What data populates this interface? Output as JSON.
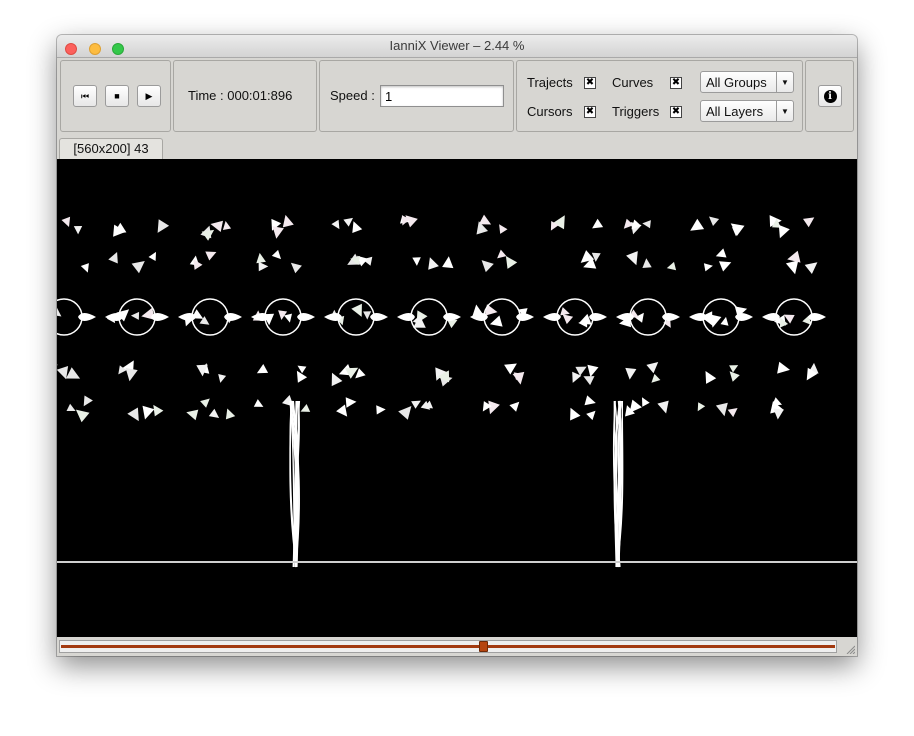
{
  "window": {
    "title": "IanniX Viewer – 2.44 %"
  },
  "transport": {
    "rewind_icon": "rewind-to-start-icon",
    "stop_icon": "stop-icon",
    "play_icon": "play-icon",
    "rewind_glyph": "⏮",
    "stop_glyph": "■",
    "play_glyph": "▶"
  },
  "time": {
    "label": "Time : 000:01:896"
  },
  "speed": {
    "label": "Speed :",
    "value": "1"
  },
  "visibility": {
    "trajects_label": "Trajects",
    "curves_label": "Curves",
    "cursors_label": "Cursors",
    "triggers_label": "Triggers",
    "check_glyph": "✖",
    "groups_selected": "All Groups",
    "layers_selected": "All Layers"
  },
  "info": {
    "glyph": "i",
    "icon": "info-icon"
  },
  "tabs": [
    {
      "label": "[560x200] 43"
    }
  ],
  "timeline": {
    "position_fraction": 0.545
  },
  "colors": {
    "canvas": "#000000",
    "objects": "#ffffff",
    "timeline_accent": "#a33a10"
  }
}
